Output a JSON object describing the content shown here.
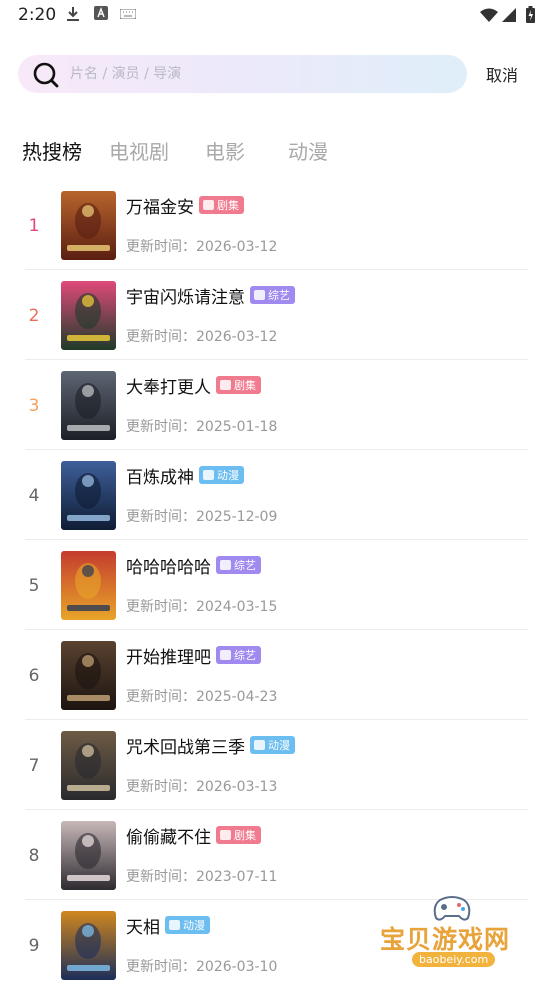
{
  "status_bar": {
    "time": "2:20",
    "left_icons": [
      "download-icon",
      "a-keyboard-icon",
      "keyboard-icon"
    ],
    "right_icons": [
      "wifi-icon",
      "signal-icon",
      "battery-icon"
    ]
  },
  "search": {
    "placeholder": "片名 / 演员 / 导演",
    "value": "",
    "cancel_label": "取消"
  },
  "tabs": [
    {
      "label": "热搜榜",
      "active": true
    },
    {
      "label": "电视剧",
      "active": false
    },
    {
      "label": "电影",
      "active": false
    },
    {
      "label": "动漫",
      "active": false
    }
  ],
  "rank_list": {
    "update_prefix": "更新时间：",
    "items": [
      {
        "rank": "1",
        "title": "万福金安",
        "badge": "剧集",
        "date": "2026-03-12",
        "rank_color": "#e0457b"
      },
      {
        "rank": "2",
        "title": "宇宙闪烁请注意",
        "badge": "综艺",
        "date": "2026-03-12",
        "rank_color": "#ef6b5c"
      },
      {
        "rank": "3",
        "title": "大奉打更人",
        "badge": "剧集",
        "date": "2025-01-18",
        "rank_color": "#f2a25a"
      },
      {
        "rank": "4",
        "title": "百炼成神",
        "badge": "动漫",
        "date": "2025-12-09",
        "rank_color": "#666666"
      },
      {
        "rank": "5",
        "title": "哈哈哈哈哈",
        "badge": "综艺",
        "date": "2024-03-15",
        "rank_color": "#666666"
      },
      {
        "rank": "6",
        "title": "开始推理吧",
        "badge": "综艺",
        "date": "2025-04-23",
        "rank_color": "#666666"
      },
      {
        "rank": "7",
        "title": "咒术回战第三季",
        "badge": "动漫",
        "date": "2026-03-13",
        "rank_color": "#666666"
      },
      {
        "rank": "8",
        "title": "偷偷藏不住",
        "badge": "剧集",
        "date": "2023-07-11",
        "rank_color": "#666666"
      },
      {
        "rank": "9",
        "title": "天相",
        "badge": "动漫",
        "date": "2026-03-10",
        "rank_color": "#666666"
      }
    ]
  },
  "badge_colors": {
    "剧集": "#f07a8e",
    "综艺": "#a08af0",
    "动漫": "#6cbdf0"
  },
  "watermark": {
    "text": "宝贝游戏网",
    "url": "baobeiy.com"
  }
}
